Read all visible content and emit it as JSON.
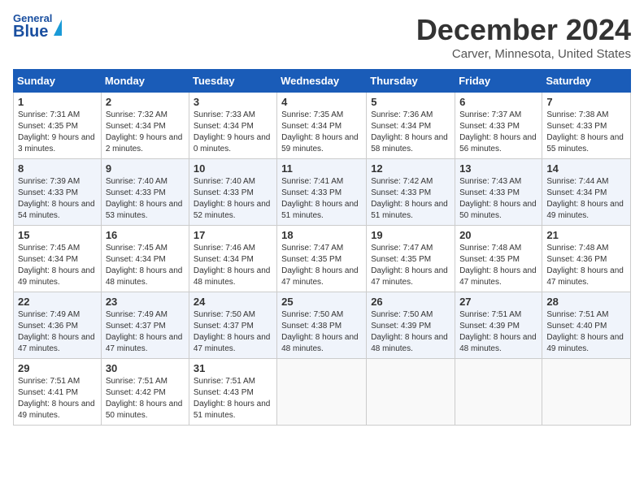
{
  "header": {
    "logo_general": "General",
    "logo_blue": "Blue",
    "month_title": "December 2024",
    "location": "Carver, Minnesota, United States"
  },
  "days_of_week": [
    "Sunday",
    "Monday",
    "Tuesday",
    "Wednesday",
    "Thursday",
    "Friday",
    "Saturday"
  ],
  "weeks": [
    [
      {
        "day": "1",
        "sunrise": "7:31 AM",
        "sunset": "4:35 PM",
        "daylight": "9 hours and 3 minutes."
      },
      {
        "day": "2",
        "sunrise": "7:32 AM",
        "sunset": "4:34 PM",
        "daylight": "9 hours and 2 minutes."
      },
      {
        "day": "3",
        "sunrise": "7:33 AM",
        "sunset": "4:34 PM",
        "daylight": "9 hours and 0 minutes."
      },
      {
        "day": "4",
        "sunrise": "7:35 AM",
        "sunset": "4:34 PM",
        "daylight": "8 hours and 59 minutes."
      },
      {
        "day": "5",
        "sunrise": "7:36 AM",
        "sunset": "4:34 PM",
        "daylight": "8 hours and 58 minutes."
      },
      {
        "day": "6",
        "sunrise": "7:37 AM",
        "sunset": "4:33 PM",
        "daylight": "8 hours and 56 minutes."
      },
      {
        "day": "7",
        "sunrise": "7:38 AM",
        "sunset": "4:33 PM",
        "daylight": "8 hours and 55 minutes."
      }
    ],
    [
      {
        "day": "8",
        "sunrise": "7:39 AM",
        "sunset": "4:33 PM",
        "daylight": "8 hours and 54 minutes."
      },
      {
        "day": "9",
        "sunrise": "7:40 AM",
        "sunset": "4:33 PM",
        "daylight": "8 hours and 53 minutes."
      },
      {
        "day": "10",
        "sunrise": "7:40 AM",
        "sunset": "4:33 PM",
        "daylight": "8 hours and 52 minutes."
      },
      {
        "day": "11",
        "sunrise": "7:41 AM",
        "sunset": "4:33 PM",
        "daylight": "8 hours and 51 minutes."
      },
      {
        "day": "12",
        "sunrise": "7:42 AM",
        "sunset": "4:33 PM",
        "daylight": "8 hours and 51 minutes."
      },
      {
        "day": "13",
        "sunrise": "7:43 AM",
        "sunset": "4:33 PM",
        "daylight": "8 hours and 50 minutes."
      },
      {
        "day": "14",
        "sunrise": "7:44 AM",
        "sunset": "4:34 PM",
        "daylight": "8 hours and 49 minutes."
      }
    ],
    [
      {
        "day": "15",
        "sunrise": "7:45 AM",
        "sunset": "4:34 PM",
        "daylight": "8 hours and 49 minutes."
      },
      {
        "day": "16",
        "sunrise": "7:45 AM",
        "sunset": "4:34 PM",
        "daylight": "8 hours and 48 minutes."
      },
      {
        "day": "17",
        "sunrise": "7:46 AM",
        "sunset": "4:34 PM",
        "daylight": "8 hours and 48 minutes."
      },
      {
        "day": "18",
        "sunrise": "7:47 AM",
        "sunset": "4:35 PM",
        "daylight": "8 hours and 47 minutes."
      },
      {
        "day": "19",
        "sunrise": "7:47 AM",
        "sunset": "4:35 PM",
        "daylight": "8 hours and 47 minutes."
      },
      {
        "day": "20",
        "sunrise": "7:48 AM",
        "sunset": "4:35 PM",
        "daylight": "8 hours and 47 minutes."
      },
      {
        "day": "21",
        "sunrise": "7:48 AM",
        "sunset": "4:36 PM",
        "daylight": "8 hours and 47 minutes."
      }
    ],
    [
      {
        "day": "22",
        "sunrise": "7:49 AM",
        "sunset": "4:36 PM",
        "daylight": "8 hours and 47 minutes."
      },
      {
        "day": "23",
        "sunrise": "7:49 AM",
        "sunset": "4:37 PM",
        "daylight": "8 hours and 47 minutes."
      },
      {
        "day": "24",
        "sunrise": "7:50 AM",
        "sunset": "4:37 PM",
        "daylight": "8 hours and 47 minutes."
      },
      {
        "day": "25",
        "sunrise": "7:50 AM",
        "sunset": "4:38 PM",
        "daylight": "8 hours and 48 minutes."
      },
      {
        "day": "26",
        "sunrise": "7:50 AM",
        "sunset": "4:39 PM",
        "daylight": "8 hours and 48 minutes."
      },
      {
        "day": "27",
        "sunrise": "7:51 AM",
        "sunset": "4:39 PM",
        "daylight": "8 hours and 48 minutes."
      },
      {
        "day": "28",
        "sunrise": "7:51 AM",
        "sunset": "4:40 PM",
        "daylight": "8 hours and 49 minutes."
      }
    ],
    [
      {
        "day": "29",
        "sunrise": "7:51 AM",
        "sunset": "4:41 PM",
        "daylight": "8 hours and 49 minutes."
      },
      {
        "day": "30",
        "sunrise": "7:51 AM",
        "sunset": "4:42 PM",
        "daylight": "8 hours and 50 minutes."
      },
      {
        "day": "31",
        "sunrise": "7:51 AM",
        "sunset": "4:43 PM",
        "daylight": "8 hours and 51 minutes."
      },
      null,
      null,
      null,
      null
    ]
  ]
}
